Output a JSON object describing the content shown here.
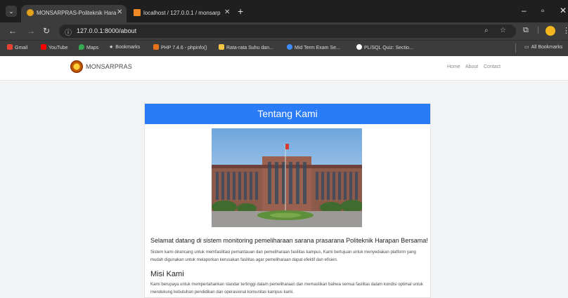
{
  "browser": {
    "tabs": [
      {
        "title": "MONSARPRAS-Politeknik Hara"
      },
      {
        "title": "localhost / 127.0.0.1 / monsarp"
      }
    ],
    "address": "127.0.0.1:8000/about",
    "bookmarks": [
      {
        "label": "Gmail",
        "icon": "gmail-icon",
        "color": "#ea4335"
      },
      {
        "label": "YouTube",
        "icon": "youtube-icon",
        "color": "#ff0000"
      },
      {
        "label": "Maps",
        "icon": "maps-icon",
        "color": "#34a853"
      },
      {
        "label": "Bookmarks",
        "icon": "star-icon",
        "color": "#e0e0e0"
      },
      {
        "label": "PHP 7.4.6 - phpinfo()",
        "icon": "php-icon",
        "color": "#e8711a"
      },
      {
        "label": "Rata-rata Suhu dan...",
        "icon": "doc-icon",
        "color": "#f4c542"
      },
      {
        "label": "Mid Term Exam Se...",
        "icon": "globe-icon",
        "color": "#3d8bfd"
      },
      {
        "label": "PL/SQL Quiz: Sectio...",
        "icon": "github-icon",
        "color": "#ffffff"
      }
    ],
    "all_bookmarks": "All Bookmarks"
  },
  "navbar": {
    "brand": "MONSARPRAS",
    "links": [
      "Home",
      "About",
      "Contact"
    ]
  },
  "content": {
    "title": "Tentang Kami",
    "welcome": "Selamat datang di sistem monitoring pemeliharaan sarana prasarana Politeknik Harapan Bersama!",
    "paragraph1": "Sistem kami dirancang untuk memfasilitasi pemantauan dan pemeliharaan fasilitas kampus. Kami bertujuan untuk menyediakan platform yang mudah digunakan untuk melaporkan kerusakan fasilitas agar pemeliharaan dapat efektif dan efisien.",
    "mission_title": "Misi Kami",
    "mission_text": "Kami berupaya untuk mempertahankan standar tertinggi dalam pemeliharaan dan memastikan bahwa semua fasilitas dalam kondisi optimal untuk mendukung kebutuhan pendidikan dan operasional komunitas kampus kami."
  },
  "colors": {
    "accent": "#2a7bf6"
  }
}
